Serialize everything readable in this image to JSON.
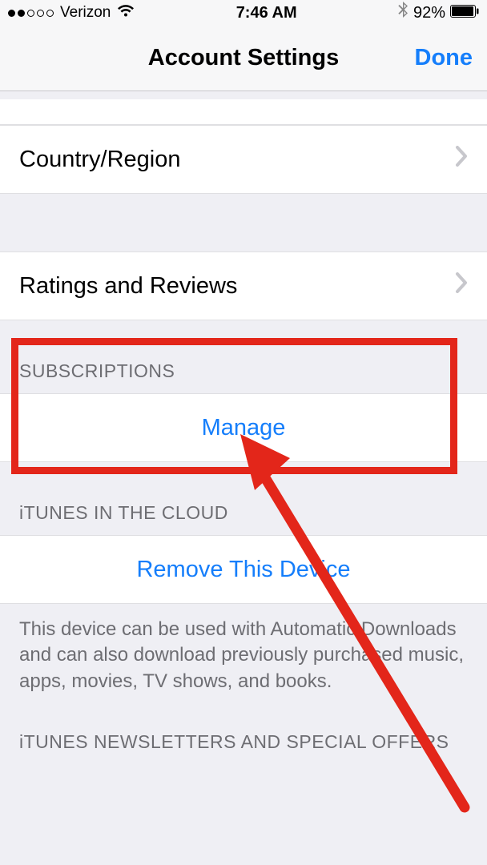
{
  "statusBar": {
    "carrier": "Verizon",
    "time": "7:46 AM",
    "batteryPercent": "92%"
  },
  "nav": {
    "title": "Account Settings",
    "done": "Done"
  },
  "cells": {
    "countryRegion": "Country/Region",
    "ratingsReviews": "Ratings and Reviews"
  },
  "sections": {
    "subscriptionsHeader": "SUBSCRIPTIONS",
    "manage": "Manage",
    "itunesCloudHeader": "iTUNES IN THE CLOUD",
    "removeDevice": "Remove This Device",
    "deviceFooter": "This device can be used with Automatic Downloads and can also download previously purchased music, apps, movies, TV shows, and books.",
    "newslettersHeader": "iTUNES NEWSLETTERS AND SPECIAL OFFERS"
  }
}
